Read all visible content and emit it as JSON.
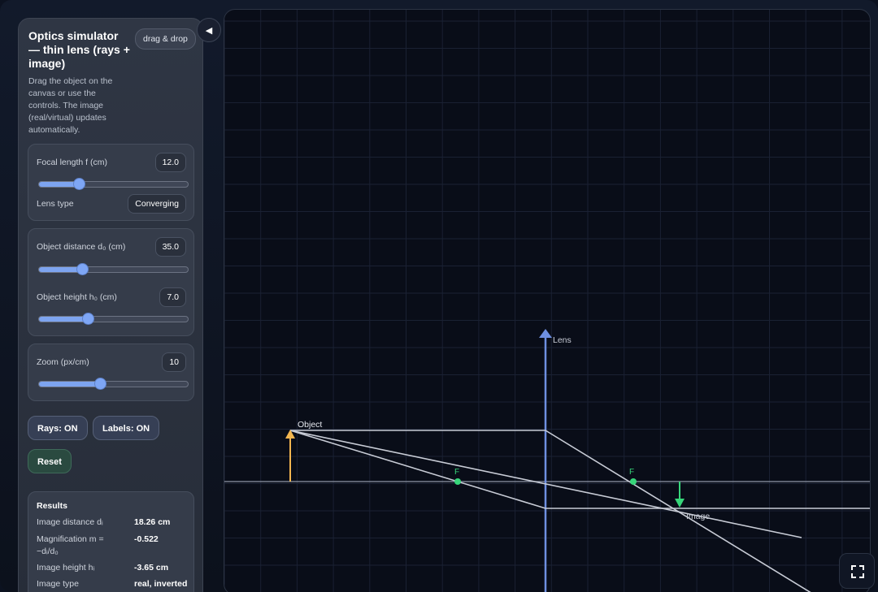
{
  "sidebar": {
    "title": "Optics simulator — thin lens (rays + image)",
    "badge": "drag & drop",
    "description": "Drag the object on the canvas or use the controls. The image (real/virtual) updates automatically.",
    "collapse_icon": "◀"
  },
  "lens_card": {
    "focal_label": "Focal length f (cm)",
    "focal_value": "12.0",
    "focal_slider": 0.27,
    "type_label": "Lens type",
    "type_value": "Converging"
  },
  "object_card": {
    "distance_label": "Object distance d₀ (cm)",
    "distance_value": "35.0",
    "distance_slider": 0.29,
    "height_label": "Object height h₀ (cm)",
    "height_value": "7.0",
    "height_slider": 0.33
  },
  "zoom_card": {
    "label": "Zoom (px/cm)",
    "value": "10",
    "slider": 0.41
  },
  "buttons": {
    "rays": "Rays: ON",
    "labels": "Labels: ON",
    "reset": "Reset"
  },
  "results": {
    "title": "Results",
    "rows": [
      {
        "label": "Image distance dᵢ",
        "value": "18.26 cm"
      },
      {
        "label": "Magnification m = −dᵢ/d₀",
        "value": "-0.522"
      },
      {
        "label": "Image height hᵢ",
        "value": "-3.65 cm"
      },
      {
        "label": "Image type",
        "value": "real, inverted"
      }
    ]
  },
  "canvas": {
    "lens_label": "Lens",
    "object_label": "Object",
    "image_label": "Image",
    "focal_left_label": "F",
    "focal_right_label": "F",
    "colors": {
      "lens": "#6e8fe0",
      "object": "#f3b650",
      "image": "#37d67a",
      "focal": "#37d67a",
      "ray": "#c8ccd6"
    }
  },
  "fullscreen_icon": "fullscreen-icon"
}
